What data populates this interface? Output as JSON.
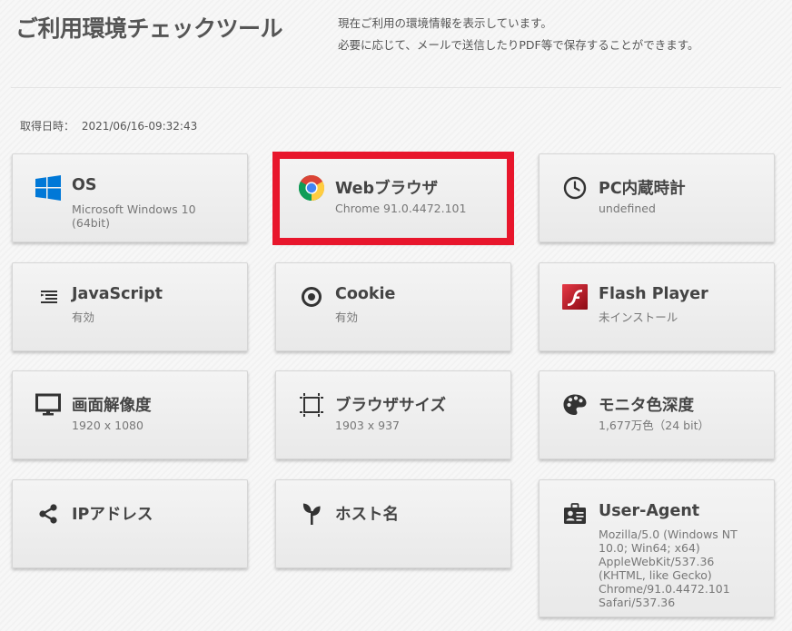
{
  "header": {
    "title": "ご利用環境チェックツール",
    "description_line1": "現在ご利用の環境情報を表示しています。",
    "description_line2": "必要に応じて、メールで送信したりPDF等で保存することができます。"
  },
  "acquired": {
    "label": "取得日時：",
    "value": "2021/06/16-09:32:43"
  },
  "cards": {
    "os": {
      "label": "OS",
      "value": "Microsoft Windows 10 (64bit)",
      "icon": "windows-icon"
    },
    "browser": {
      "label": "Webブラウザ",
      "value": "Chrome 91.0.4472.101",
      "icon": "chrome-icon"
    },
    "clock": {
      "label": "PC内蔵時計",
      "value": "undefined",
      "icon": "clock-icon"
    },
    "javascript": {
      "label": "JavaScript",
      "value": "有効",
      "icon": "script-lines-icon"
    },
    "cookie": {
      "label": "Cookie",
      "value": "有効",
      "icon": "cookie-icon"
    },
    "flash": {
      "label": "Flash Player",
      "value": "未インストール",
      "icon": "flash-icon"
    },
    "resolution": {
      "label": "画面解像度",
      "value": "1920 x 1080",
      "icon": "monitor-icon"
    },
    "browser_size": {
      "label": "ブラウザサイズ",
      "value": "1903 x 937",
      "icon": "crop-frame-icon"
    },
    "color_depth": {
      "label": "モニタ色深度",
      "value": "1,677万色（24 bit）",
      "icon": "palette-icon"
    },
    "ip": {
      "label": "IPアドレス",
      "value": "",
      "icon": "share-icon"
    },
    "host": {
      "label": "ホスト名",
      "value": "",
      "icon": "sprout-icon"
    },
    "user_agent": {
      "label": "User-Agent",
      "value": "Mozilla/5.0 (Windows NT 10.0; Win64; x64) AppleWebKit/537.36 (KHTML, like Gecko) Chrome/91.0.4472.101 Safari/537.36",
      "icon": "id-card-icon"
    }
  },
  "colors": {
    "highlight": "#e8162c",
    "windows_blue": "#0078d7",
    "flash_red": "#c1121f"
  }
}
